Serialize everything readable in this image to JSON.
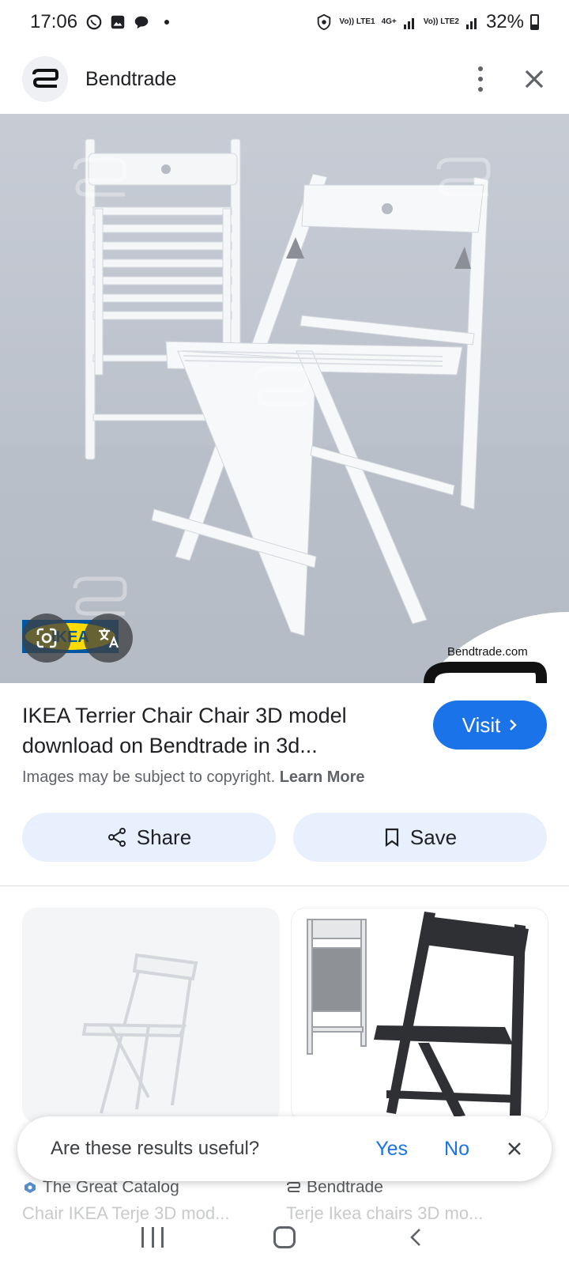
{
  "status_bar": {
    "time": "17:06",
    "battery": "32%",
    "net1": "Vo)) LTE1",
    "net2": "4G+",
    "net3": "Vo)) LTE2"
  },
  "header": {
    "site_name": "Bendtrade"
  },
  "hero": {
    "brand_caption": "Bendtrade.com"
  },
  "result": {
    "title": "IKEA Terrier Chair Chair 3D model download on Bendtrade in 3d...",
    "visit_label": "Visit",
    "copyright_text": "Images may be subject to copyright.",
    "learn_more": "Learn More"
  },
  "actions": {
    "share_label": "Share",
    "save_label": "Save"
  },
  "related": [
    {
      "source": "The Great Catalog",
      "title": "Chair IKEA Terje 3D mod..."
    },
    {
      "source": "Bendtrade",
      "title": "Terje Ikea chairs 3D mo..."
    }
  ],
  "feedback": {
    "question": "Are these results useful?",
    "yes": "Yes",
    "no": "No"
  },
  "colors": {
    "accent": "#1a73e8",
    "chip_bg": "#e8f0fe"
  }
}
